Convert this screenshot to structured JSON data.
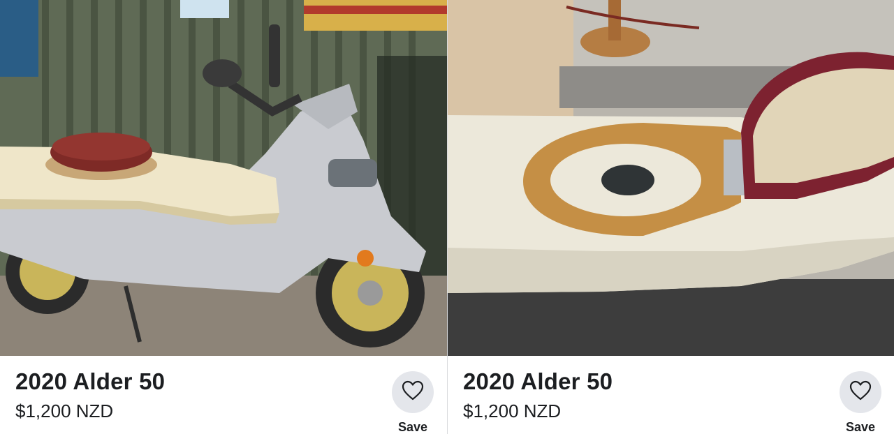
{
  "listings": [
    {
      "title": "2020 Alder 50",
      "price": "$1,200 NZD",
      "save_label": "Save",
      "photo_alt": "scooter with toilet seat"
    },
    {
      "title": "2020 Alder 50",
      "price": "$1,200 NZD",
      "save_label": "Save",
      "photo_alt": "toilet seat on scooter body"
    }
  ],
  "colors": {
    "text": "#1c1e21",
    "button_bg": "#e4e6eb",
    "divider": "#d9dadc"
  },
  "icons": {
    "save": "heart-icon"
  }
}
